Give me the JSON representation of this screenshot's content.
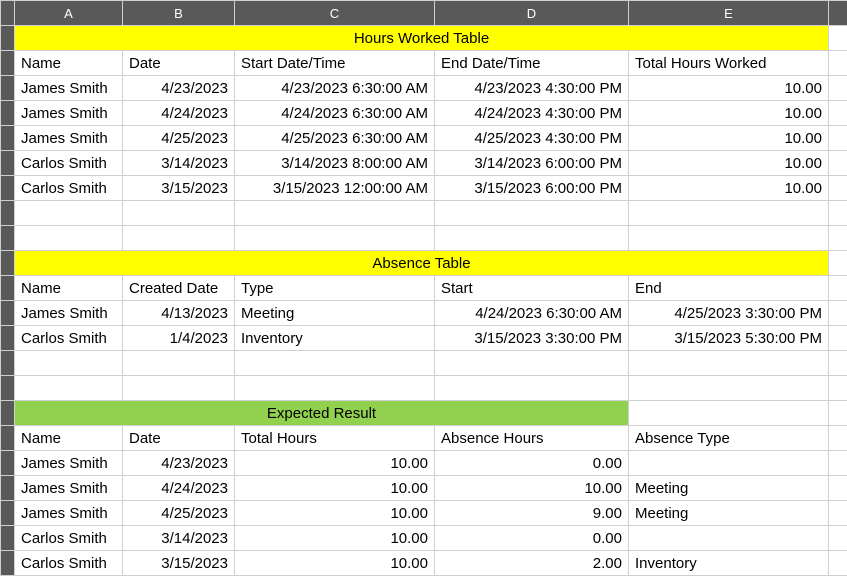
{
  "columns": [
    "A",
    "B",
    "C",
    "D",
    "E"
  ],
  "hours_worked": {
    "title": "Hours Worked Table",
    "headers": [
      "Name",
      "Date",
      "Start Date/Time",
      "End Date/Time",
      "Total Hours Worked"
    ],
    "rows": [
      {
        "name": "James Smith",
        "date": "4/23/2023",
        "start": "4/23/2023 6:30:00 AM",
        "end": "4/23/2023 4:30:00 PM",
        "total": "10.00"
      },
      {
        "name": "James Smith",
        "date": "4/24/2023",
        "start": "4/24/2023 6:30:00 AM",
        "end": "4/24/2023 4:30:00 PM",
        "total": "10.00"
      },
      {
        "name": "James Smith",
        "date": "4/25/2023",
        "start": "4/25/2023 6:30:00 AM",
        "end": "4/25/2023 4:30:00 PM",
        "total": "10.00"
      },
      {
        "name": "Carlos Smith",
        "date": "3/14/2023",
        "start": "3/14/2023 8:00:00 AM",
        "end": "3/14/2023 6:00:00 PM",
        "total": "10.00"
      },
      {
        "name": "Carlos Smith",
        "date": "3/15/2023",
        "start": "3/15/2023 12:00:00 AM",
        "end": "3/15/2023 6:00:00 PM",
        "total": "10.00"
      }
    ]
  },
  "absence": {
    "title": "Absence Table",
    "headers": [
      "Name",
      "Created Date",
      "Type",
      "Start",
      "End"
    ],
    "rows": [
      {
        "name": "James Smith",
        "created": "4/13/2023",
        "type": "Meeting",
        "start": "4/24/2023 6:30:00 AM",
        "end": "4/25/2023 3:30:00 PM"
      },
      {
        "name": "Carlos Smith",
        "created": "1/4/2023",
        "type": "Inventory",
        "start": "3/15/2023 3:30:00 PM",
        "end": "3/15/2023 5:30:00 PM"
      }
    ]
  },
  "expected": {
    "title": "Expected Result",
    "headers": [
      "Name",
      "Date",
      "Total Hours",
      "Absence Hours",
      "Absence Type"
    ],
    "rows": [
      {
        "name": "James Smith",
        "date": "4/23/2023",
        "total": "10.00",
        "abs": "0.00",
        "type": ""
      },
      {
        "name": "James Smith",
        "date": "4/24/2023",
        "total": "10.00",
        "abs": "10.00",
        "type": "Meeting"
      },
      {
        "name": "James Smith",
        "date": "4/25/2023",
        "total": "10.00",
        "abs": "9.00",
        "type": "Meeting"
      },
      {
        "name": "Carlos Smith",
        "date": "3/14/2023",
        "total": "10.00",
        "abs": "0.00",
        "type": ""
      },
      {
        "name": "Carlos Smith",
        "date": "3/15/2023",
        "total": "10.00",
        "abs": "2.00",
        "type": "Inventory"
      }
    ]
  }
}
